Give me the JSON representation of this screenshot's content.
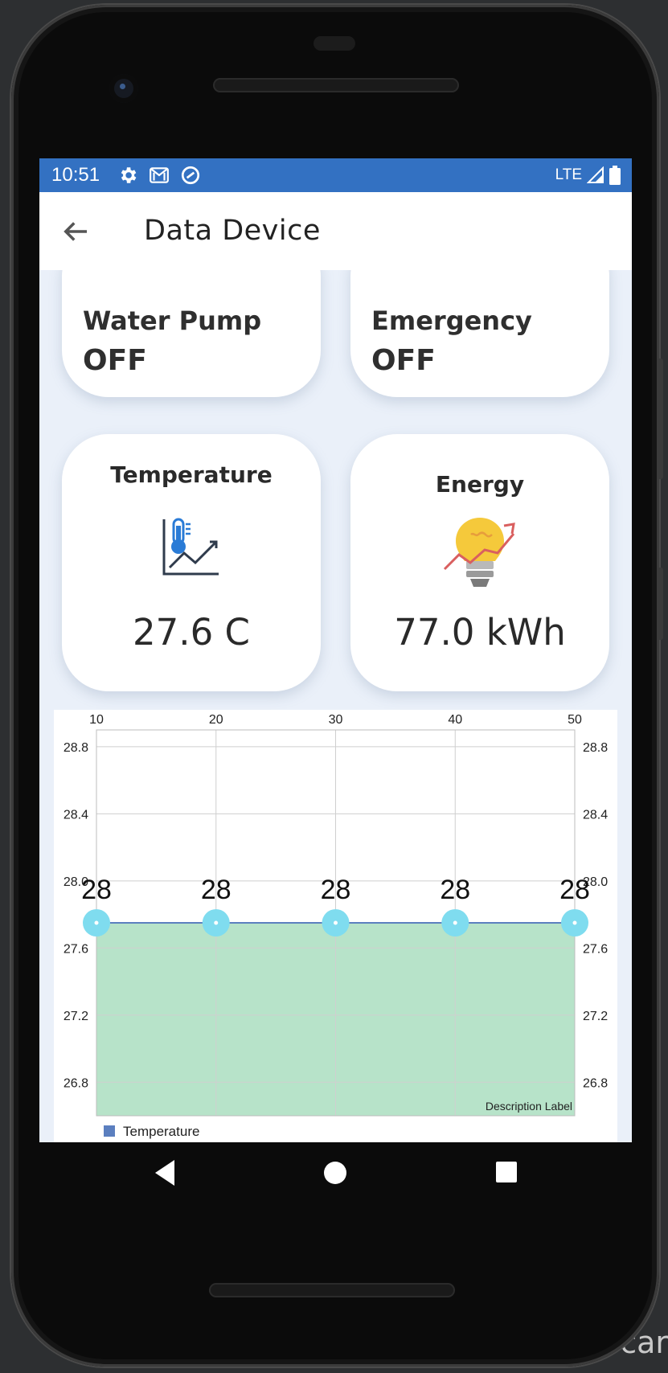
{
  "status_bar": {
    "time": "10:51",
    "network": "LTE",
    "left_icons": [
      "gear-icon",
      "gmail-icon",
      "data-saver-icon"
    ],
    "right_icons": [
      "signal-icon",
      "battery-icon"
    ],
    "color": "#3371c2"
  },
  "app_bar": {
    "title": "Data Device",
    "back_icon": "arrow-back-icon"
  },
  "devices": [
    {
      "label": "Water Pump",
      "status": "OFF"
    },
    {
      "label": "Emergency",
      "status": "OFF"
    }
  ],
  "sensors": [
    {
      "title": "Temperature",
      "value": "27.6 C",
      "icon": "thermometer-chart-icon"
    },
    {
      "title": "Energy",
      "value": "77.0 kWh",
      "icon": "lightbulb-chart-icon"
    }
  ],
  "chart_data": {
    "type": "area",
    "x": [
      10,
      20,
      30,
      40,
      50
    ],
    "x_tick_labels": [
      "10",
      "20",
      "30",
      "40",
      "50"
    ],
    "xlim": [
      10,
      50
    ],
    "xaxis_position": "top",
    "ylim": [
      26.6,
      28.9
    ],
    "y_tick_labels": [
      "28.8",
      "28.4",
      "28.0",
      "27.6",
      "27.2",
      "26.8"
    ],
    "y_ticks": [
      28.8,
      28.4,
      28.0,
      27.6,
      27.2,
      26.8
    ],
    "y_axes": "left-and-right",
    "series": [
      {
        "name": "Temperature",
        "values": [
          27.75,
          27.75,
          27.75,
          27.75,
          27.75
        ],
        "point_labels": [
          "28",
          "28",
          "28",
          "28",
          "28"
        ],
        "color": "#5b7fbf",
        "fill": "#b7e3c9",
        "marker_color": "#7fdcef"
      }
    ],
    "description": "Description Label",
    "legend": "bottom-left",
    "grid": true
  },
  "nav": {
    "back": "nav-back-icon",
    "home": "nav-home-icon",
    "recents": "nav-recents-icon"
  },
  "ide_snippet": "e\ncar"
}
